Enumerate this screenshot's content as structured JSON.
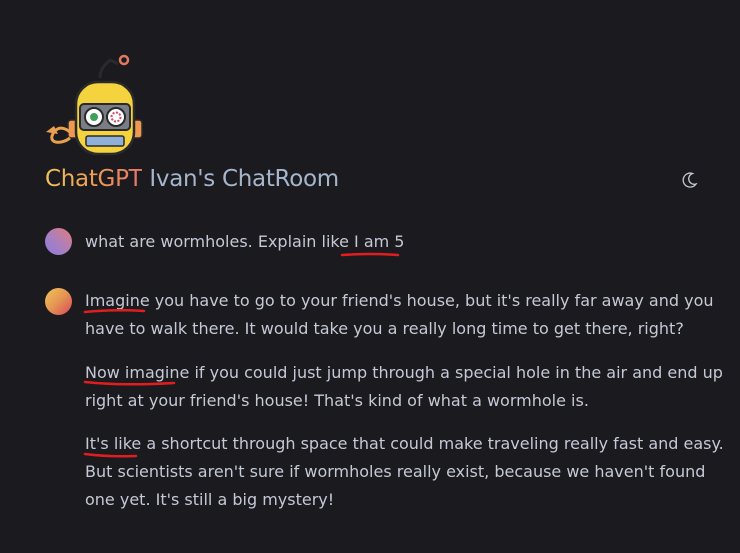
{
  "header": {
    "brand": "ChatGPT",
    "room_name": "Ivan's ChatRoom",
    "theme_icon": "moon-icon"
  },
  "logo": {
    "icon": "robot-logo-icon"
  },
  "messages": {
    "user": {
      "avatar_colors": [
        "#8e7ae0",
        "#e07c7c"
      ],
      "text": "what are wormholes. Explain like I am 5"
    },
    "bot": {
      "avatar_colors": [
        "#f0c557",
        "#d9455a"
      ],
      "p1_line1": "Imagine you have to go to your friend's house, but it's really far away and you",
      "p1_line2": "have to walk there. It would take you a really long time to get there, right?",
      "p2_line1": "Now imagine if you could just jump through a special hole in the air and end up",
      "p2_line2": "right at your friend's house! That's kind of what a wormhole is.",
      "p3_line1": "It's like a shortcut through space that could make traveling really fast and easy.",
      "p3_line2": "But scientists aren't sure if wormholes really exist, because we haven't found",
      "p3_line3": "one yet. It's still a big mystery!"
    }
  },
  "annotations": {
    "underline_color": "#e01e1e"
  }
}
